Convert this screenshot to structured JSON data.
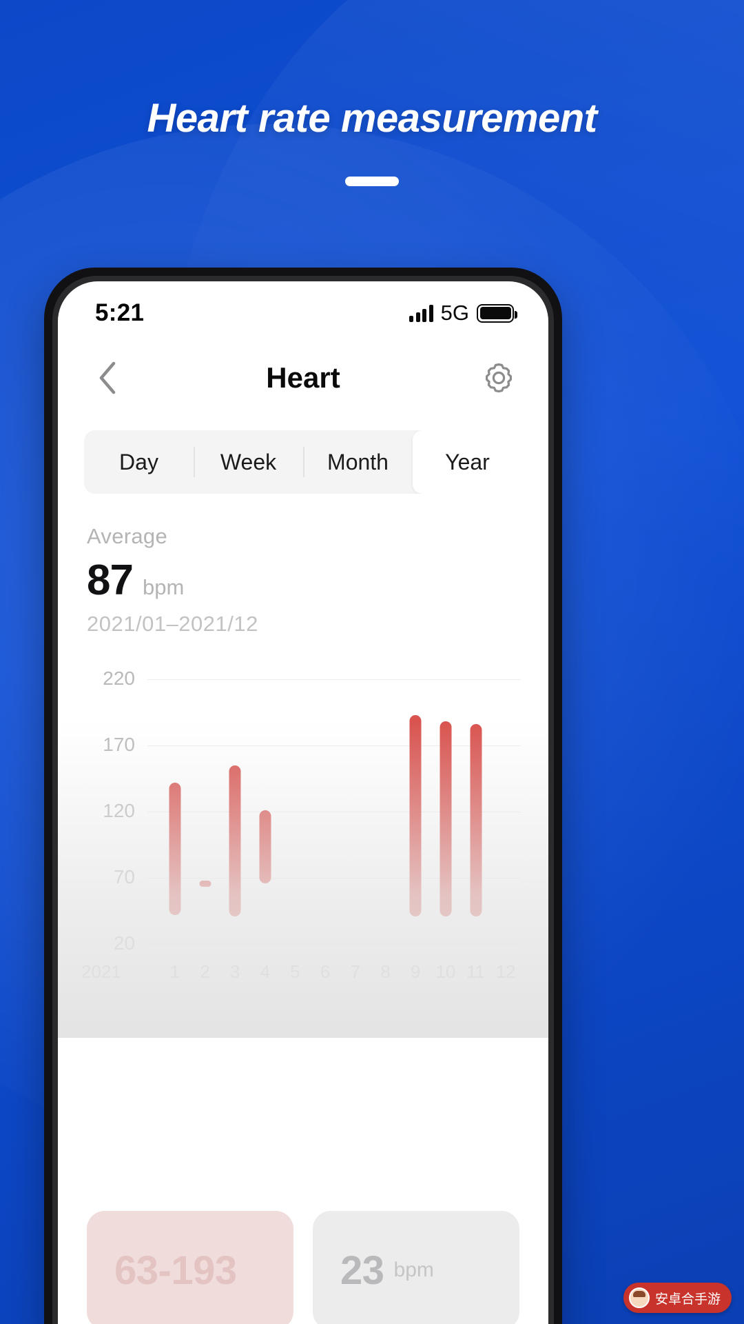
{
  "promo": {
    "title": "Heart rate measurement",
    "accent_color": "#0f4fd6"
  },
  "status_bar": {
    "time": "5:21",
    "network": "5G",
    "signal_icon": "signal-bars-icon",
    "battery_icon": "battery-full-icon"
  },
  "navbar": {
    "back_icon": "chevron-left-icon",
    "title": "Heart",
    "settings_icon": "gear-icon"
  },
  "tabs": [
    {
      "label": "Day",
      "selected": false
    },
    {
      "label": "Week",
      "selected": false
    },
    {
      "label": "Month",
      "selected": false
    },
    {
      "label": "Year",
      "selected": true
    }
  ],
  "summary": {
    "label": "Average",
    "value": "87",
    "unit": "bpm",
    "range": "2021/01–2021/12"
  },
  "cards": [
    {
      "name": "range-card",
      "value": "63-193",
      "unit": ""
    },
    {
      "name": "resting-card",
      "value": "23",
      "unit": "bpm"
    }
  ],
  "watermark": {
    "text": "安卓合手游",
    "icon": "app-face-icon"
  },
  "chart_data": {
    "type": "bar",
    "title": "",
    "xlabel": "",
    "ylabel": "",
    "bar_color": "#d9534f",
    "grid": true,
    "legend_position": "none",
    "year_label": "2021",
    "categories": [
      "1",
      "2",
      "3",
      "4",
      "5",
      "6",
      "7",
      "8",
      "9",
      "10",
      "11",
      "12"
    ],
    "yticks": [
      220,
      170,
      120,
      70,
      20
    ],
    "ylim": [
      20,
      220
    ],
    "ranges": [
      {
        "category": "1",
        "low": 42,
        "high": 142
      },
      {
        "category": "2",
        "low": 63,
        "high": 68
      },
      {
        "category": "3",
        "low": 41,
        "high": 155
      },
      {
        "category": "4",
        "low": 66,
        "high": 121
      },
      {
        "category": "5",
        "low": null,
        "high": null
      },
      {
        "category": "6",
        "low": null,
        "high": null
      },
      {
        "category": "7",
        "low": null,
        "high": null
      },
      {
        "category": "8",
        "low": null,
        "high": null
      },
      {
        "category": "9",
        "low": 41,
        "high": 193
      },
      {
        "category": "10",
        "low": 41,
        "high": 188
      },
      {
        "category": "11",
        "low": 41,
        "high": 186
      },
      {
        "category": "12",
        "low": null,
        "high": null
      }
    ]
  }
}
